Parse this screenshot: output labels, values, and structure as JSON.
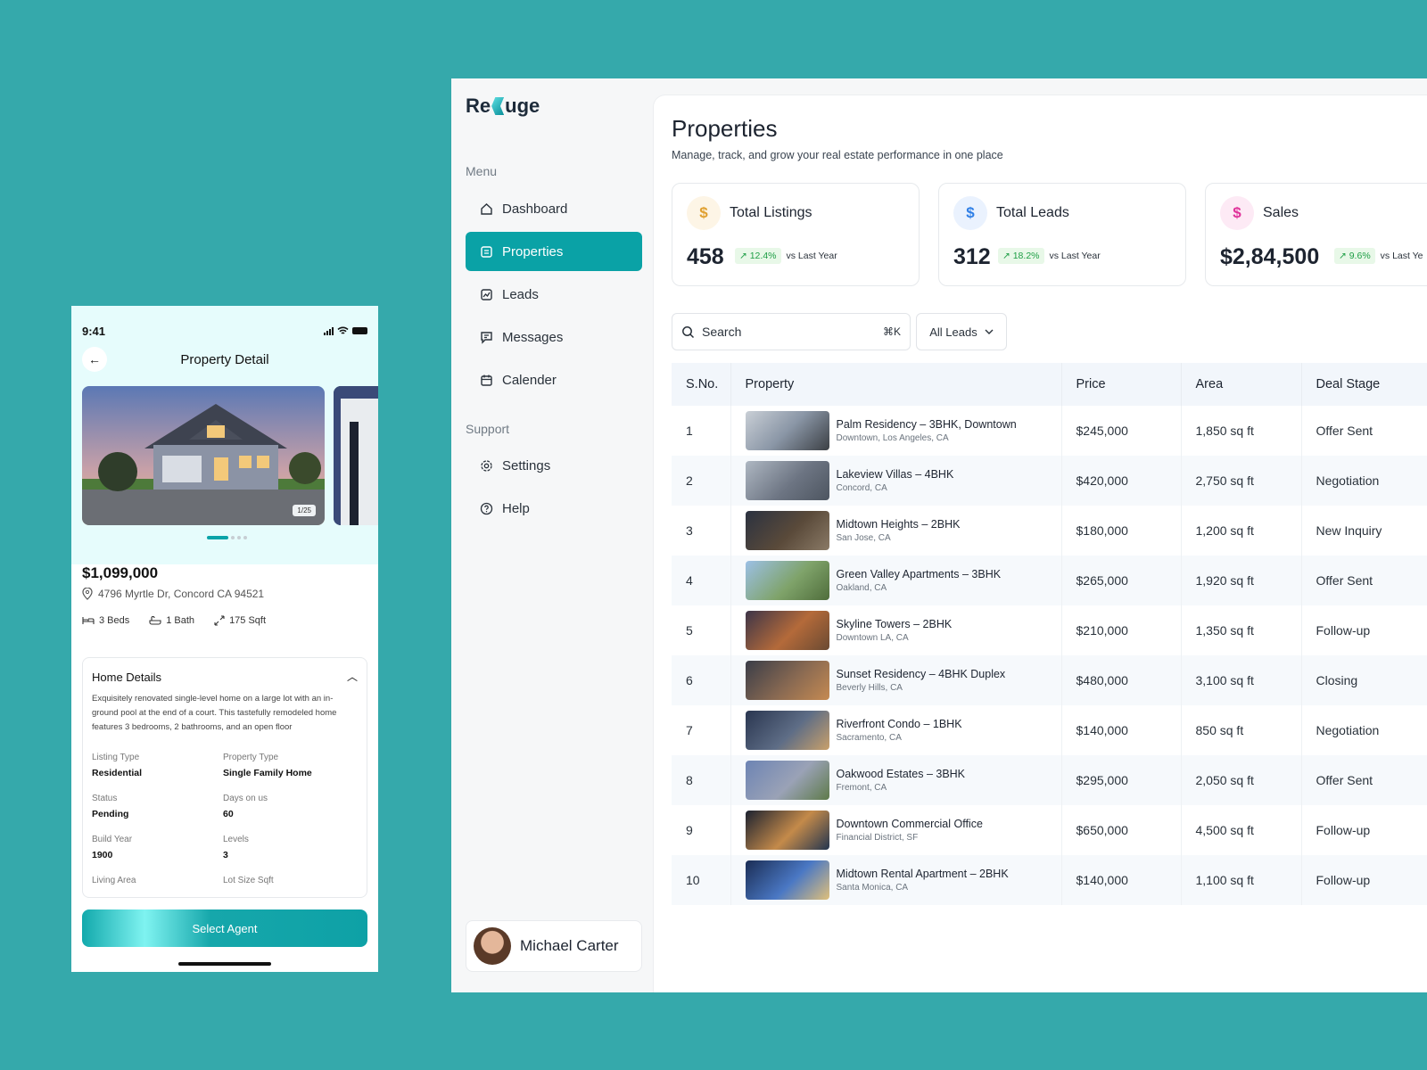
{
  "mobile": {
    "status_time": "9:41",
    "title": "Property Detail",
    "image_counter": "1/25",
    "price": "$1,099,000",
    "address": "4796 Myrtle Dr, Concord CA 94521",
    "features": {
      "beds": "3 Beds",
      "baths": "1 Bath",
      "area": "175 Sqft"
    },
    "details_title": "Home Details",
    "details_desc": "Exquisitely renovated single-level home on a large lot with an in-ground pool at the end of a court. This tastefully remodeled home features 3 bedrooms, 2 bathrooms, and an open floor",
    "details": [
      {
        "key": "Listing Type",
        "value": "Residential"
      },
      {
        "key": "Property Type",
        "value": "Single Family Home"
      },
      {
        "key": "Status",
        "value": "Pending"
      },
      {
        "key": "Days on us",
        "value": "60"
      },
      {
        "key": "Build Year",
        "value": "1900"
      },
      {
        "key": "Levels",
        "value": "3"
      },
      {
        "key": "Living Area",
        "value": ""
      },
      {
        "key": "Lot Size Sqft",
        "value": ""
      }
    ],
    "cta": "Select Agent"
  },
  "sidebar": {
    "logo_left": "Re",
    "logo_right": "uge",
    "menu_heading": "Menu",
    "menu": [
      {
        "label": "Dashboard",
        "icon": "home-icon"
      },
      {
        "label": "Properties",
        "icon": "building-icon",
        "active": true
      },
      {
        "label": "Leads",
        "icon": "chart-icon"
      },
      {
        "label": "Messages",
        "icon": "message-icon"
      },
      {
        "label": "Calender",
        "icon": "calendar-icon"
      }
    ],
    "support_heading": "Support",
    "support": [
      {
        "label": "Settings",
        "icon": "gear-icon"
      },
      {
        "label": "Help",
        "icon": "help-icon"
      }
    ],
    "user_name": "Michael Carter"
  },
  "page": {
    "title": "Properties",
    "subtitle": "Manage, track, and grow your real estate performance in one place"
  },
  "stats": [
    {
      "label": "Total Listings",
      "value": "458",
      "growth": "12.4%",
      "compare": "vs Last Year",
      "icon": "$",
      "color": "#e0a030",
      "bg": "#fdf5e6"
    },
    {
      "label": "Total Leads",
      "value": "312",
      "growth": "18.2%",
      "compare": "vs Last Year",
      "icon": "$",
      "color": "#2f7fe6",
      "bg": "#eaf2fe"
    },
    {
      "label": "Sales",
      "value": "$2,84,500",
      "growth": "9.6%",
      "compare": "vs Last Ye",
      "icon": "$",
      "color": "#e0329a",
      "bg": "#fdeaf5"
    }
  ],
  "toolbar": {
    "search_placeholder": "Search",
    "search_shortcut": "⌘K",
    "filter_label": "All Leads"
  },
  "table": {
    "columns": [
      "S.No.",
      "Property",
      "Price",
      "Area",
      "Deal Stage"
    ],
    "rows": [
      {
        "no": "1",
        "name": "Palm Residency – 3BHK, Downtown",
        "loc": "Downtown, Los Angeles, CA",
        "price": "$245,000",
        "area": "1,850 sq ft",
        "stage": "Offer Sent"
      },
      {
        "no": "2",
        "name": "Lakeview Villas – 4BHK",
        "loc": "Concord, CA",
        "price": "$420,000",
        "area": "2,750 sq ft",
        "stage": "Negotiation"
      },
      {
        "no": "3",
        "name": "Midtown Heights – 2BHK",
        "loc": "San Jose, CA",
        "price": "$180,000",
        "area": "1,200 sq ft",
        "stage": "New Inquiry"
      },
      {
        "no": "4",
        "name": "Green Valley Apartments – 3BHK",
        "loc": "Oakland, CA",
        "price": "$265,000",
        "area": "1,920 sq ft",
        "stage": "Offer Sent"
      },
      {
        "no": "5",
        "name": "Skyline Towers – 2BHK",
        "loc": "Downtown LA, CA",
        "price": "$210,000",
        "area": "1,350 sq ft",
        "stage": "Follow-up"
      },
      {
        "no": "6",
        "name": "Sunset Residency – 4BHK Duplex",
        "loc": "Beverly Hills, CA",
        "price": "$480,000",
        "area": "3,100 sq ft",
        "stage": "Closing"
      },
      {
        "no": "7",
        "name": "Riverfront Condo – 1BHK",
        "loc": "Sacramento, CA",
        "price": "$140,000",
        "area": "850 sq ft",
        "stage": "Negotiation"
      },
      {
        "no": "8",
        "name": "Oakwood Estates – 3BHK",
        "loc": "Fremont, CA",
        "price": "$295,000",
        "area": "2,050 sq ft",
        "stage": "Offer Sent"
      },
      {
        "no": "9",
        "name": "Downtown Commercial Office",
        "loc": "Financial District, SF",
        "price": "$650,000",
        "area": "4,500 sq ft",
        "stage": "Follow-up"
      },
      {
        "no": "10",
        "name": "Midtown Rental Apartment – 2BHK",
        "loc": "Santa Monica, CA",
        "price": "$140,000",
        "area": "1,100 sq ft",
        "stage": "Follow-up"
      }
    ]
  },
  "colors": {
    "background": "#35a9ab",
    "accent": "#0aa2a6",
    "growth": "#1e9e45"
  }
}
